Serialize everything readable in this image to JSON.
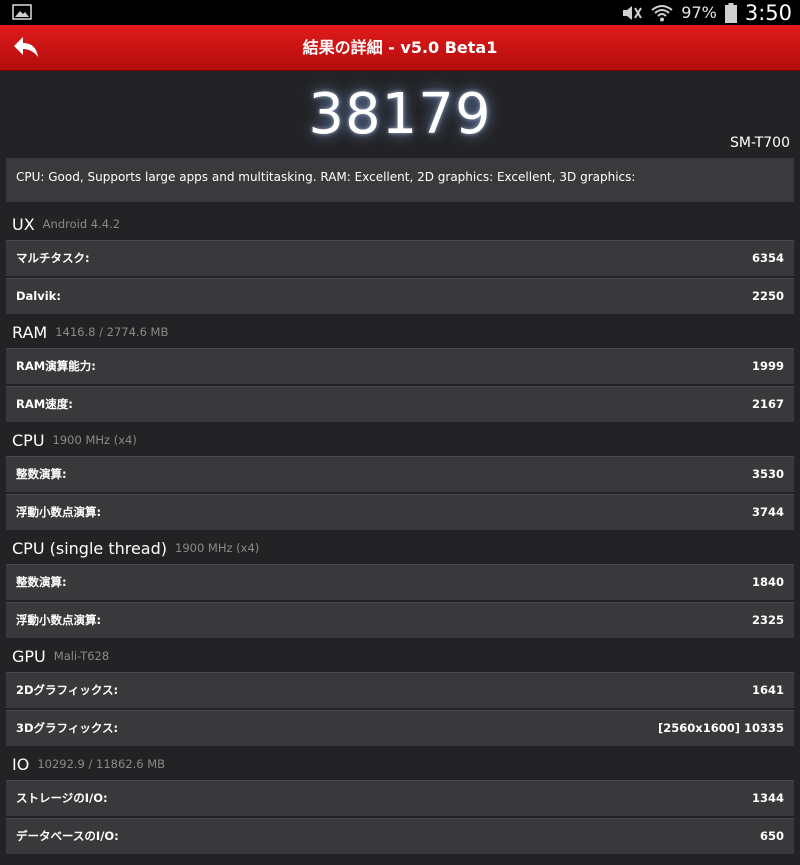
{
  "status_bar": {
    "battery": "97%",
    "time": "3:50"
  },
  "header": {
    "title": "結果の詳細 - v5.0 Beta1"
  },
  "score": "38179",
  "device": "SM-T700",
  "summary": "CPU: Good, Supports large apps and multitasking. RAM: Excellent, 2D graphics: Excellent, 3D graphics:",
  "sections": {
    "ux": {
      "name": "UX",
      "sub": "Android 4.4.2",
      "rows": [
        {
          "label": "マルチタスク:",
          "value": "6354"
        },
        {
          "label": "Dalvik:",
          "value": "2250"
        }
      ]
    },
    "ram": {
      "name": "RAM",
      "sub": "1416.8 / 2774.6 MB",
      "rows": [
        {
          "label": "RAM演算能力:",
          "value": "1999"
        },
        {
          "label": "RAM速度:",
          "value": "2167"
        }
      ]
    },
    "cpu": {
      "name": "CPU",
      "sub": "1900 MHz (x4)",
      "rows": [
        {
          "label": "整数演算:",
          "value": "3530"
        },
        {
          "label": "浮動小数点演算:",
          "value": "3744"
        }
      ]
    },
    "cpu_single": {
      "name": "CPU (single thread)",
      "sub": "1900 MHz (x4)",
      "rows": [
        {
          "label": "整数演算:",
          "value": "1840"
        },
        {
          "label": "浮動小数点演算:",
          "value": "2325"
        }
      ]
    },
    "gpu": {
      "name": "GPU",
      "sub": "Mali-T628",
      "rows": [
        {
          "label": "2Dグラフィックス:",
          "value": "1641"
        },
        {
          "label": "3Dグラフィックス:",
          "value": "[2560x1600] 10335"
        }
      ]
    },
    "io": {
      "name": "IO",
      "sub": "10292.9 / 11862.6 MB",
      "rows": [
        {
          "label": "ストレージのI/O:",
          "value": "1344"
        },
        {
          "label": "データベースのI/O:",
          "value": "650"
        }
      ]
    }
  }
}
